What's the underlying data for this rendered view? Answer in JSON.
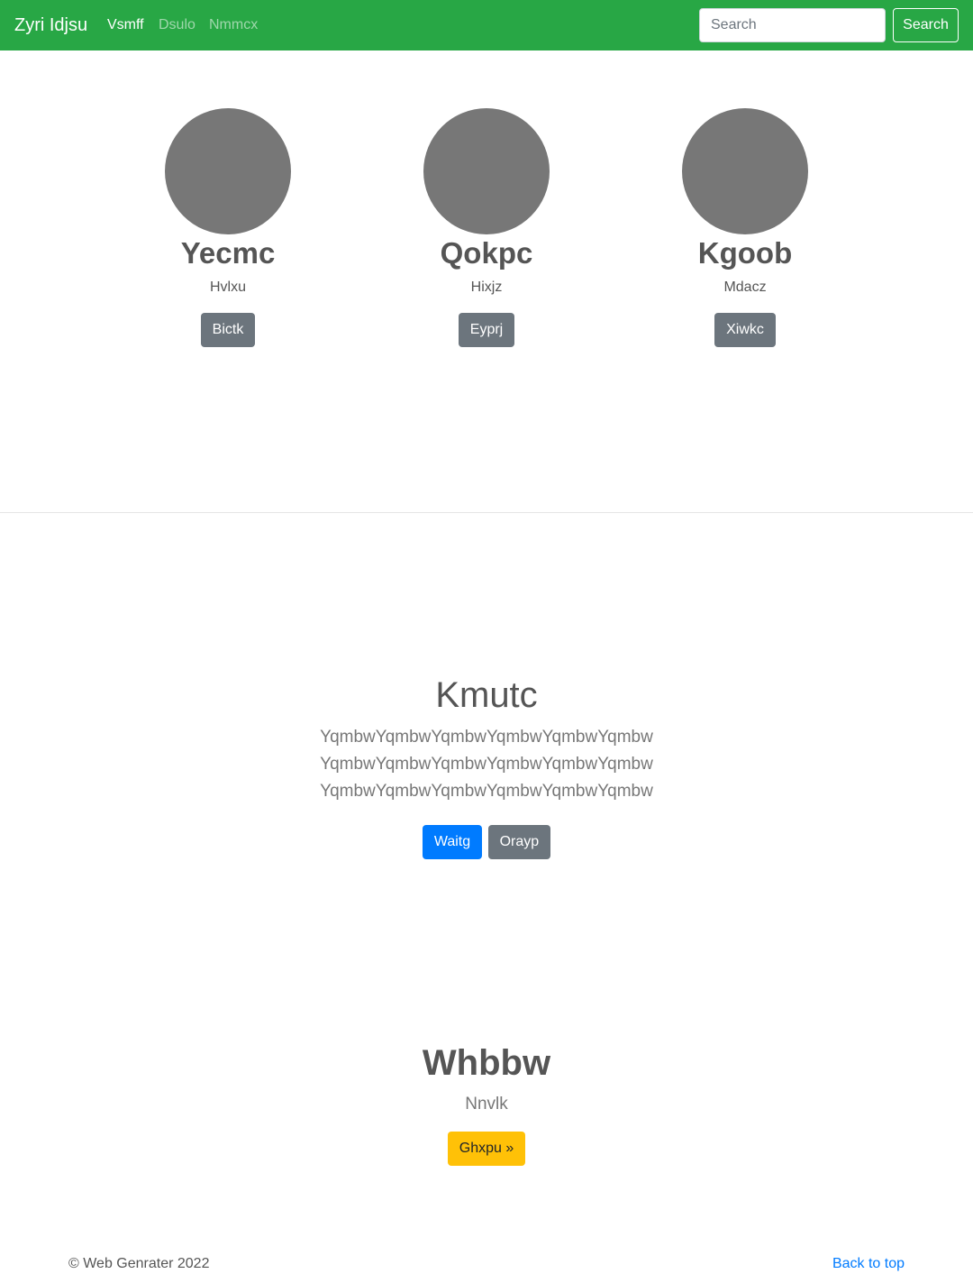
{
  "navbar": {
    "brand": "Zyri Idjsu",
    "links": [
      "Vsmff",
      "Dsulo",
      "Nmmcx"
    ],
    "search_placeholder": "Search",
    "search_button": "Search"
  },
  "profiles": [
    {
      "name": "Yecmc",
      "subtitle": "Hvlxu",
      "button": "Bictk"
    },
    {
      "name": "Qokpc",
      "subtitle": "Hixjz",
      "button": "Eyprj"
    },
    {
      "name": "Kgoob",
      "subtitle": "Mdacz",
      "button": "Xiwkc"
    }
  ],
  "hero": {
    "title": "Kmutc",
    "lines": [
      "YqmbwYqmbwYqmbwYqmbwYqmbwYqmbw",
      "YqmbwYqmbwYqmbwYqmbwYqmbwYqmbw",
      "YqmbwYqmbwYqmbwYqmbwYqmbwYqmbw"
    ],
    "primary_button": "Waitg",
    "secondary_button": "Orayp"
  },
  "feature": {
    "title": "Whbbw",
    "subtitle": "Nnvlk",
    "button": "Ghxpu »"
  },
  "footer": {
    "copyright": "© Web Genrater 2022",
    "back_to_top": "Back to top"
  },
  "colors": {
    "navbar": "#28a745",
    "avatar": "#777777",
    "secondary": "#6c757d",
    "primary": "#007bff",
    "warning": "#ffc107"
  }
}
